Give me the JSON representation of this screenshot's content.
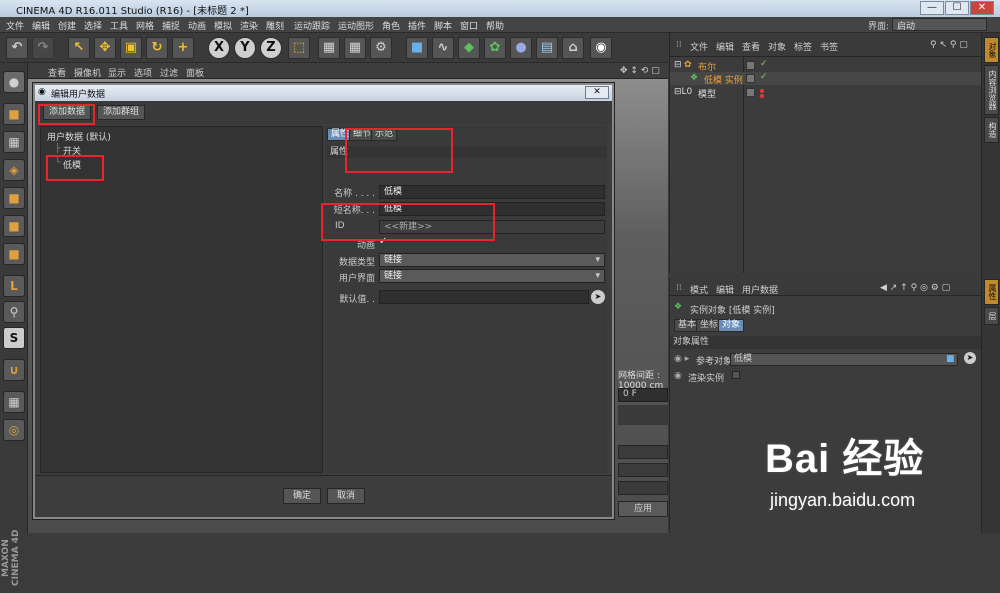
{
  "window": {
    "title": "CINEMA 4D R16.011 Studio (R16) - [未标题 2 *]",
    "min": "—",
    "max": "☐",
    "close": "✕"
  },
  "menubar": {
    "items": [
      "文件",
      "编辑",
      "创建",
      "选择",
      "工具",
      "网格",
      "捕捉",
      "动画",
      "模拟",
      "渲染",
      "雕刻",
      "运动跟踪",
      "运动图形",
      "角色",
      "插件",
      "脚本",
      "窗口",
      "帮助"
    ],
    "layout_label": "界面:",
    "layout_value": "启动"
  },
  "viewport": {
    "menu": [
      "查看",
      "摄像机",
      "显示",
      "选项",
      "过滤",
      "面板"
    ],
    "scale_label": "网格间距 : 10000 cm",
    "frame_value": "0 F",
    "apply_label": "应用"
  },
  "dialog": {
    "title": "编辑用户数据",
    "close": "✕",
    "add_data": "添加数据",
    "add_group": "添加群组",
    "tree": {
      "root": "用户数据 (默认)",
      "children": [
        "开关",
        "低模"
      ]
    },
    "tabs": [
      "属性",
      "细节",
      "示范"
    ],
    "section": "属性",
    "fields": {
      "name_label": "名称 . . . .",
      "name_value": "低模",
      "short_label": "短名称. . .",
      "short_value": "低模",
      "id_label": "ID",
      "id_value": "<<新建>>",
      "anim_label": "动画",
      "anim_value": "✓",
      "datatype_label": "数据类型",
      "datatype_value": "链接",
      "ui_label": "用户界面",
      "ui_value": "链接",
      "default_label": "默认值. .",
      "default_value": ""
    },
    "ok": "确定",
    "cancel": "取消"
  },
  "object_manager": {
    "menu": [
      "文件",
      "编辑",
      "查看",
      "对象",
      "标签",
      "书签"
    ],
    "rows": [
      {
        "name": "布尔",
        "color": "#e8a23a"
      },
      {
        "name": "低模 实例",
        "color": "#e8a23a"
      },
      {
        "name": "模型",
        "color": "#dddddd"
      }
    ]
  },
  "attribute_manager": {
    "menu": [
      "模式",
      "编辑",
      "用户数据"
    ],
    "object_title": "实例对象 [低模 实例]",
    "tabs": [
      "基本",
      "坐标",
      "对象"
    ],
    "section": "对象属性",
    "ref_label": "参考对象",
    "ref_value": "低模",
    "render_label": "渲染实例"
  },
  "right_tabs": [
    "对象",
    "内容浏览器",
    "构造",
    "属性",
    "层"
  ],
  "watermark": {
    "brand": "Bai 经验",
    "url": "jingyan.baidu.com"
  },
  "brand_vertical": "MAXON CINEMA 4D",
  "colors": {
    "annotation_red": "#e8252b",
    "active_tab": "#6c8cb8",
    "object_orange": "#e8a23a"
  }
}
